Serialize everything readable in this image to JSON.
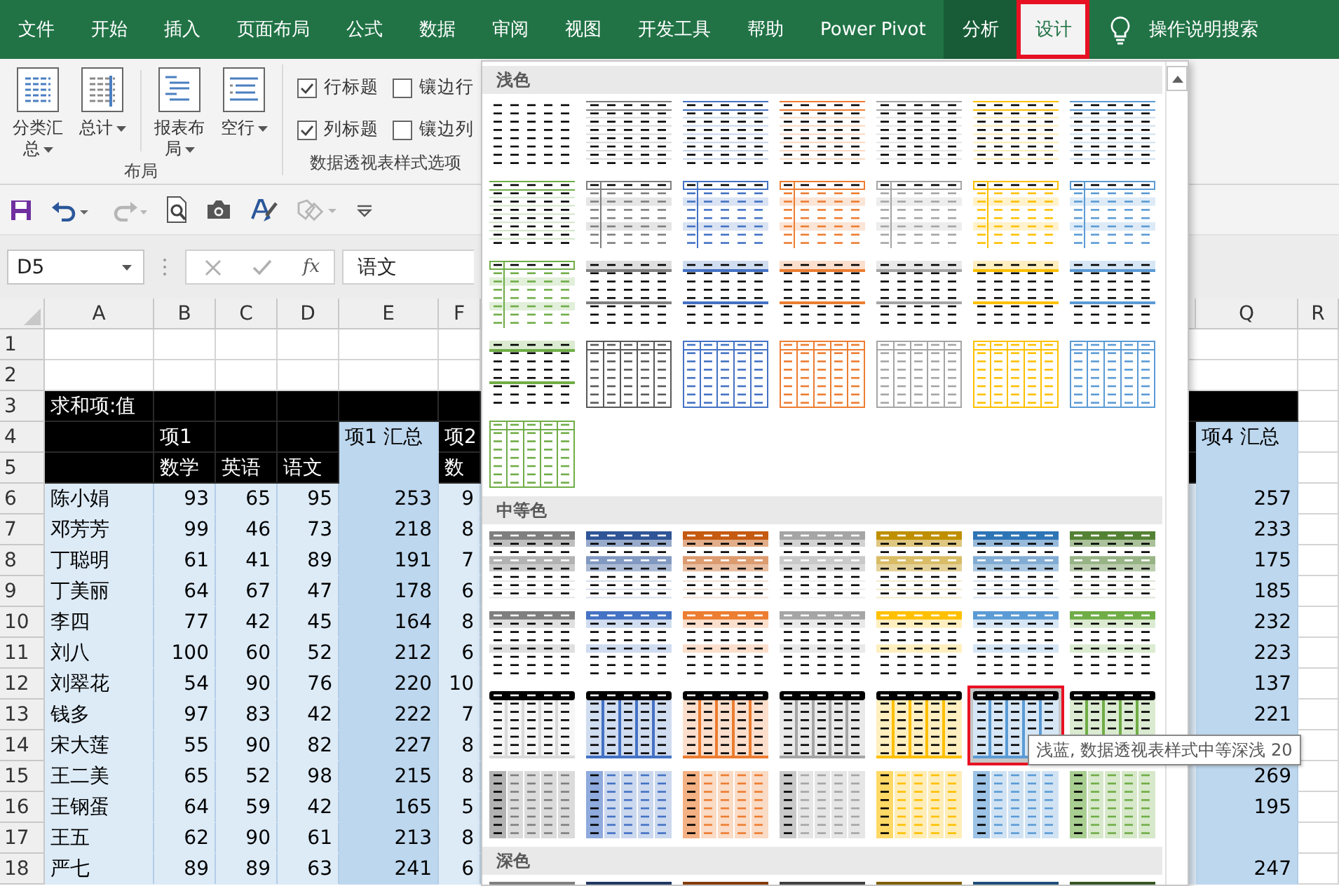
{
  "tabs": [
    {
      "label": "文件",
      "kind": "normal",
      "selected": false
    },
    {
      "label": "开始",
      "kind": "normal",
      "selected": false
    },
    {
      "label": "插入",
      "kind": "normal",
      "selected": false
    },
    {
      "label": "页面布局",
      "kind": "normal",
      "selected": false
    },
    {
      "label": "公式",
      "kind": "normal",
      "selected": false
    },
    {
      "label": "数据",
      "kind": "normal",
      "selected": false
    },
    {
      "label": "审阅",
      "kind": "normal",
      "selected": false
    },
    {
      "label": "视图",
      "kind": "normal",
      "selected": false
    },
    {
      "label": "开发工具",
      "kind": "normal",
      "selected": false
    },
    {
      "label": "帮助",
      "kind": "normal",
      "selected": false
    },
    {
      "label": "Power Pivot",
      "kind": "normal",
      "selected": false
    },
    {
      "label": "分析",
      "kind": "contextual",
      "selected": false
    },
    {
      "label": "设计",
      "kind": "contextual",
      "selected": true
    }
  ],
  "tell_me": {
    "label": "操作说明搜索"
  },
  "ribbon": {
    "groups": [
      {
        "kind": "buttons",
        "label": "布局",
        "buttons": [
          {
            "label": "分类汇总",
            "separator_before": false
          },
          {
            "label": "总计",
            "separator_before": false
          },
          {
            "label": "报表布局",
            "separator_before": true
          },
          {
            "label": "空行",
            "separator_before": false
          }
        ]
      },
      {
        "kind": "checks",
        "label": "数据透视表样式选项",
        "options": [
          {
            "label": "行标题",
            "checked": true
          },
          {
            "label": "镶边行",
            "checked": false
          },
          {
            "label": "列标题",
            "checked": true
          },
          {
            "label": "镶边列",
            "checked": false
          }
        ]
      }
    ]
  },
  "quick_access_toolbar": [
    {
      "kind": "save",
      "disabled": false
    },
    {
      "kind": "undo",
      "disabled": false
    },
    {
      "kind": "redo",
      "disabled": true
    },
    {
      "kind": "print-preview",
      "disabled": false
    },
    {
      "kind": "camera",
      "disabled": false
    },
    {
      "kind": "spelling",
      "disabled": false
    },
    {
      "kind": "shapes",
      "disabled": true
    },
    {
      "kind": "customize",
      "disabled": false
    }
  ],
  "formula_bar": {
    "name_box": "D5",
    "function_button": "fx",
    "value": "语文"
  },
  "sheet": {
    "columns": [
      {
        "label": "A",
        "kind": "label"
      },
      {
        "label": "B",
        "kind": "number"
      },
      {
        "label": "C",
        "kind": "number"
      },
      {
        "label": "D",
        "kind": "number"
      },
      {
        "label": "E",
        "kind": "total"
      },
      {
        "label": "F",
        "kind": "number"
      },
      {
        "label": "Q",
        "kind": "total"
      },
      {
        "label": "R",
        "kind": "empty"
      }
    ],
    "rows": [
      {
        "number": "1",
        "kind": "blank",
        "cells": [
          null,
          null,
          null,
          null,
          null,
          null,
          null,
          null
        ]
      },
      {
        "number": "2",
        "kind": "blank",
        "cells": [
          null,
          null,
          null,
          null,
          null,
          null,
          null,
          null
        ]
      },
      {
        "number": "3",
        "kind": "title",
        "cells": [
          "求和项:值",
          null,
          null,
          null,
          null,
          null,
          null,
          null
        ]
      },
      {
        "number": "4",
        "kind": "header",
        "cells": [
          null,
          "项1",
          null,
          null,
          "项1 汇总",
          "项2",
          "项4 汇总",
          null
        ]
      },
      {
        "number": "5",
        "kind": "header",
        "cells": [
          null,
          "数学",
          "英语",
          "语文",
          null,
          "数",
          null,
          null
        ]
      },
      {
        "number": "6",
        "kind": "data",
        "cells": [
          "陈小娟",
          "93",
          "65",
          "95",
          "253",
          "9",
          "257",
          null
        ]
      },
      {
        "number": "7",
        "kind": "data",
        "cells": [
          "邓芳芳",
          "99",
          "46",
          "73",
          "218",
          "8",
          "233",
          null
        ]
      },
      {
        "number": "8",
        "kind": "data",
        "cells": [
          "丁聪明",
          "61",
          "41",
          "89",
          "191",
          "7",
          "175",
          null
        ]
      },
      {
        "number": "9",
        "kind": "data",
        "cells": [
          "丁美丽",
          "64",
          "67",
          "47",
          "178",
          "6",
          "185",
          null
        ]
      },
      {
        "number": "10",
        "kind": "data",
        "cells": [
          "李四",
          "77",
          "42",
          "45",
          "164",
          "8",
          "232",
          null
        ]
      },
      {
        "number": "11",
        "kind": "data",
        "cells": [
          "刘八",
          "100",
          "60",
          "52",
          "212",
          "6",
          "223",
          null
        ]
      },
      {
        "number": "12",
        "kind": "data",
        "cells": [
          "刘翠花",
          "54",
          "90",
          "76",
          "220",
          "10",
          "137",
          null
        ]
      },
      {
        "number": "13",
        "kind": "data",
        "cells": [
          "钱多",
          "97",
          "83",
          "42",
          "222",
          "7",
          "221",
          null
        ]
      },
      {
        "number": "14",
        "kind": "data",
        "cells": [
          "宋大莲",
          "55",
          "90",
          "82",
          "227",
          "8",
          null,
          null
        ]
      },
      {
        "number": "15",
        "kind": "data",
        "cells": [
          "王二美",
          "65",
          "52",
          "98",
          "215",
          "8",
          "269",
          null
        ]
      },
      {
        "number": "16",
        "kind": "data",
        "cells": [
          "王钢蛋",
          "64",
          "59",
          "42",
          "165",
          "5",
          "195",
          null
        ]
      },
      {
        "number": "17",
        "kind": "data",
        "cells": [
          "王五",
          "62",
          "90",
          "61",
          "213",
          "8",
          null,
          null
        ]
      },
      {
        "number": "18",
        "kind": "data",
        "cells": [
          "严七",
          "89",
          "89",
          "63",
          "241",
          "6",
          "247",
          null
        ]
      }
    ]
  },
  "gallery": {
    "sections": [
      {
        "title": "浅色",
        "styles": [
          {
            "kind": "plain",
            "color": "#000000",
            "selected": false
          },
          {
            "kind": "lines",
            "color": "#7f7f7f",
            "selected": false
          },
          {
            "kind": "lines",
            "color": "#4472c4",
            "selected": false
          },
          {
            "kind": "lines",
            "color": "#ed7d31",
            "selected": false
          },
          {
            "kind": "lines",
            "color": "#a5a5a5",
            "selected": false
          },
          {
            "kind": "lines",
            "color": "#ffc000",
            "selected": false
          },
          {
            "kind": "lines",
            "color": "#5b9bd5",
            "selected": false
          },
          {
            "kind": "lines",
            "color": "#70ad47",
            "selected": false
          },
          {
            "kind": "framed",
            "color": "#7f7f7f",
            "selected": false
          },
          {
            "kind": "framed",
            "color": "#4472c4",
            "selected": false
          },
          {
            "kind": "framed",
            "color": "#ed7d31",
            "selected": false
          },
          {
            "kind": "framed",
            "color": "#a5a5a5",
            "selected": false
          },
          {
            "kind": "framed",
            "color": "#ffc000",
            "selected": false
          },
          {
            "kind": "framed",
            "color": "#5b9bd5",
            "selected": false
          },
          {
            "kind": "framed",
            "color": "#70ad47",
            "selected": false
          },
          {
            "kind": "band",
            "color": "#7f7f7f",
            "selected": false
          },
          {
            "kind": "band",
            "color": "#4472c4",
            "selected": false
          },
          {
            "kind": "band",
            "color": "#ed7d31",
            "selected": false
          },
          {
            "kind": "band",
            "color": "#a5a5a5",
            "selected": false
          },
          {
            "kind": "band",
            "color": "#ffc000",
            "selected": false
          },
          {
            "kind": "band",
            "color": "#5b9bd5",
            "selected": false
          },
          {
            "kind": "band",
            "color": "#70ad47",
            "selected": false
          },
          {
            "kind": "grid",
            "color": "#595959",
            "selected": false
          },
          {
            "kind": "grid",
            "color": "#4472c4",
            "selected": false
          },
          {
            "kind": "grid",
            "color": "#ed7d31",
            "selected": false
          },
          {
            "kind": "grid",
            "color": "#a5a5a5",
            "selected": false
          },
          {
            "kind": "grid",
            "color": "#ffc000",
            "selected": false
          },
          {
            "kind": "grid",
            "color": "#5b9bd5",
            "selected": false
          },
          {
            "kind": "grid",
            "color": "#70ad47",
            "selected": false
          }
        ]
      },
      {
        "title": "中等色",
        "styles": [
          {
            "kind": "dark-header",
            "color": "#7f7f7f",
            "selected": false
          },
          {
            "kind": "dark-header",
            "color": "#2f5597",
            "selected": false
          },
          {
            "kind": "dark-header",
            "color": "#c55a11",
            "selected": false
          },
          {
            "kind": "dark-header",
            "color": "#a5a5a5",
            "selected": false
          },
          {
            "kind": "dark-header",
            "color": "#bf8f00",
            "selected": false
          },
          {
            "kind": "dark-header",
            "color": "#2e75b6",
            "selected": false
          },
          {
            "kind": "dark-header",
            "color": "#548235",
            "selected": false
          },
          {
            "kind": "medium-header",
            "color": "#7f7f7f",
            "selected": false
          },
          {
            "kind": "medium-header",
            "color": "#4472c4",
            "selected": false
          },
          {
            "kind": "medium-header",
            "color": "#ed7d31",
            "selected": false
          },
          {
            "kind": "medium-header",
            "color": "#a5a5a5",
            "selected": false
          },
          {
            "kind": "medium-header",
            "color": "#ffc000",
            "selected": false
          },
          {
            "kind": "medium-header",
            "color": "#5b9bd5",
            "selected": false
          },
          {
            "kind": "medium-header",
            "color": "#70ad47",
            "selected": false
          },
          {
            "kind": "black-header",
            "color": "#d9d9d9",
            "selected": false
          },
          {
            "kind": "black-header",
            "color": "#4472c4",
            "selected": false
          },
          {
            "kind": "black-header",
            "color": "#ed7d31",
            "selected": false
          },
          {
            "kind": "black-header",
            "color": "#a5a5a5",
            "selected": false
          },
          {
            "kind": "black-header",
            "color": "#ffc000",
            "selected": false
          },
          {
            "kind": "black-header",
            "color": "#5b9bd5",
            "selected": true
          },
          {
            "kind": "black-header",
            "color": "#70ad47",
            "selected": false
          },
          {
            "kind": "column-bands",
            "color": "#7f7f7f",
            "selected": false
          },
          {
            "kind": "column-bands",
            "color": "#4472c4",
            "selected": false
          },
          {
            "kind": "column-bands",
            "color": "#ed7d31",
            "selected": false
          },
          {
            "kind": "column-bands",
            "color": "#a5a5a5",
            "selected": false
          },
          {
            "kind": "column-bands",
            "color": "#ffc000",
            "selected": false
          },
          {
            "kind": "column-bands",
            "color": "#5b9bd5",
            "selected": false
          },
          {
            "kind": "column-bands",
            "color": "#70ad47",
            "selected": false
          }
        ]
      },
      {
        "title": "深色",
        "styles": [
          {
            "kind": "dark",
            "color": "#7f7f7f",
            "selected": false
          },
          {
            "kind": "dark",
            "color": "#203864",
            "selected": false
          },
          {
            "kind": "dark",
            "color": "#843c0c",
            "selected": false
          },
          {
            "kind": "dark",
            "color": "#404040",
            "selected": false
          },
          {
            "kind": "dark",
            "color": "#7f6000",
            "selected": false
          },
          {
            "kind": "dark",
            "color": "#1f4e79",
            "selected": false
          },
          {
            "kind": "dark",
            "color": "#375623",
            "selected": false
          }
        ]
      }
    ],
    "tooltip": "浅蓝, 数据透视表样式中等深浅 20"
  }
}
